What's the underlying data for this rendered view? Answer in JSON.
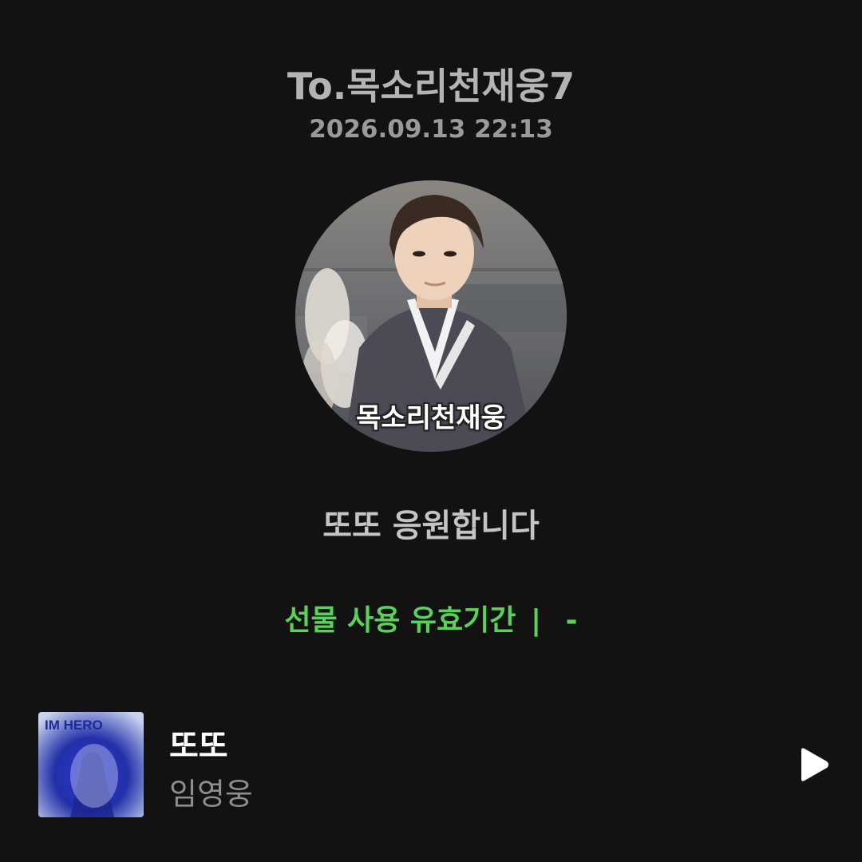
{
  "header": {
    "recipient": "To.목소리천재웅7",
    "timestamp": "2026.09.13 22:13"
  },
  "profile": {
    "caption": "목소리천재웅"
  },
  "message": "또또 응원합니다",
  "validity": {
    "label": "선물 사용 유효기간",
    "separator": "|",
    "value": "-"
  },
  "track": {
    "title": "또또",
    "artist": "임영웅",
    "album_art_text": "IM HERO"
  },
  "colors": {
    "background": "#121212",
    "accent_green": "#5ad25a"
  },
  "icons": {
    "play": "play-icon"
  }
}
